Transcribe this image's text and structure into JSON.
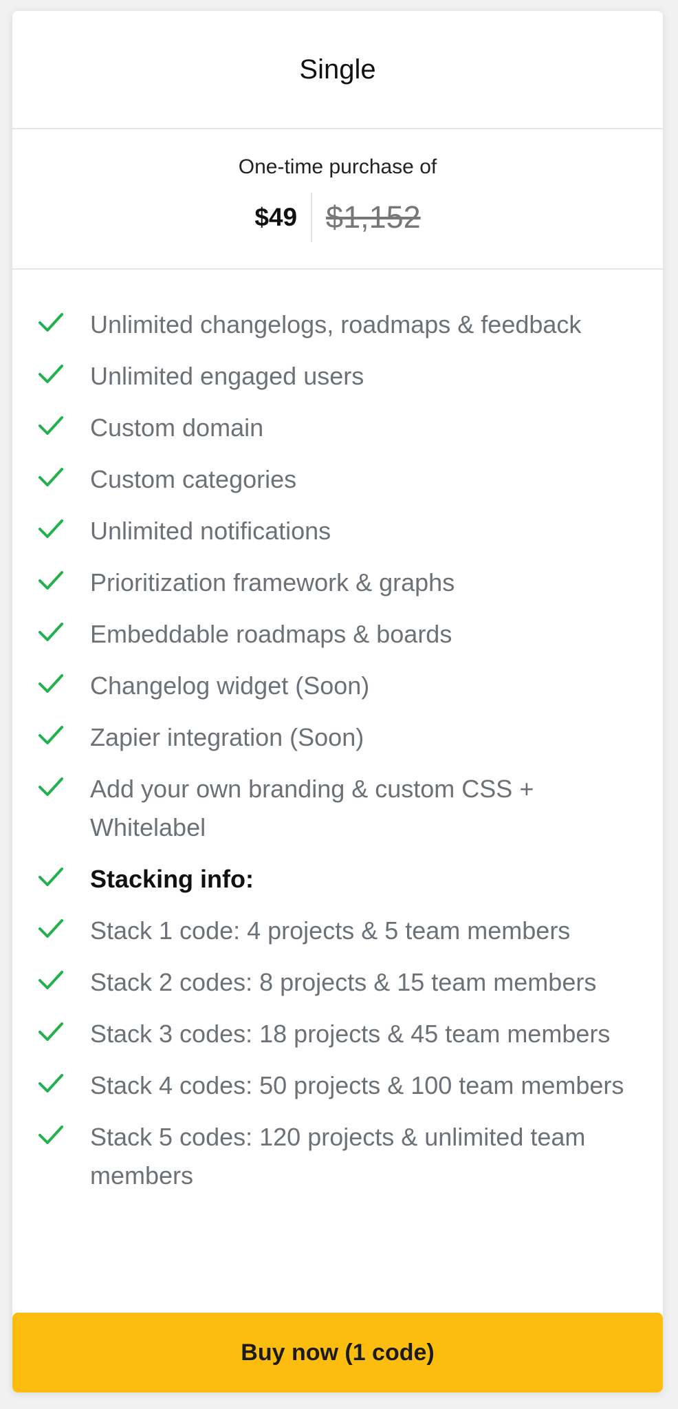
{
  "plan": {
    "name": "Single"
  },
  "pricing": {
    "caption": "One-time purchase of",
    "current_price": "$49",
    "original_price": "$1,152"
  },
  "features": [
    {
      "text": "Unlimited changelogs, roadmaps & feedback",
      "bold": false
    },
    {
      "text": "Unlimited engaged users",
      "bold": false
    },
    {
      "text": "Custom domain",
      "bold": false
    },
    {
      "text": "Custom categories",
      "bold": false
    },
    {
      "text": "Unlimited notifications",
      "bold": false
    },
    {
      "text": "Prioritization framework & graphs",
      "bold": false
    },
    {
      "text": "Embeddable roadmaps & boards",
      "bold": false
    },
    {
      "text": "Changelog widget (Soon)",
      "bold": false
    },
    {
      "text": "Zapier integration (Soon)",
      "bold": false
    },
    {
      "text": "Add your own branding & custom CSS + Whitelabel",
      "bold": false
    },
    {
      "text": "Stacking info:",
      "bold": true
    },
    {
      "text": "Stack 1 code: 4 projects & 5 team members",
      "bold": false
    },
    {
      "text": "Stack 2 codes: 8 projects & 15 team members",
      "bold": false
    },
    {
      "text": "Stack 3 codes: 18 projects & 45 team members",
      "bold": false
    },
    {
      "text": "Stack 4 codes: 50 projects & 100 team members",
      "bold": false
    },
    {
      "text": "Stack 5 codes: 120 projects & unlimited team members",
      "bold": false
    }
  ],
  "cta": {
    "label": "Buy now (1 code)"
  },
  "icons": {
    "feature_check": "check-icon"
  },
  "colors": {
    "accent": "#fdbd0f",
    "check": "#22b14c",
    "feature_text": "#6c7177",
    "heading_text": "#111111"
  }
}
